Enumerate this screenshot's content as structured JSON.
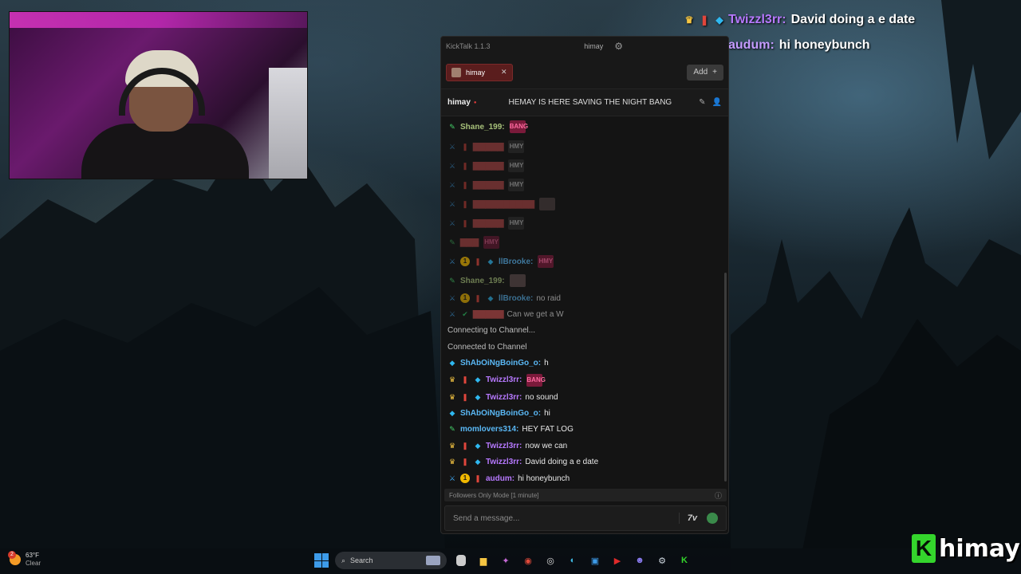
{
  "overlay_chat": [
    {
      "user": "Twizzl3rr:",
      "text": "David doing a e date",
      "user_color": "#b779ff"
    },
    {
      "user": "audum:",
      "text": "hi honeybunch",
      "user_color": "#c59cff"
    }
  ],
  "kicktalk": {
    "app_title": "KickTalk 1.1.3",
    "titlebar_user": "himay",
    "tab_label": "himay",
    "add_label": "Add",
    "channel_name": "himay",
    "stream_title": "HEMAY IS HERE SAVING THE NIGHT BANG",
    "followers_mode": "Followers Only Mode [1 minute]",
    "input_placeholder": "Send a message...",
    "messages": {
      "m1_user": "Shane_199:",
      "m7_user": "llBrooke:",
      "m8_user": "Shane_199:",
      "m9_user": "llBrooke:",
      "m9_text": "no raid",
      "m10_text": "Can we get a W",
      "sys1": "Connecting to Channel...",
      "sys2": "Connected to Channel",
      "m11_user": "ShAbOiNgBoinGo_o:",
      "m11_text": "h",
      "m12_user": "Twizzl3rr:",
      "m13_user": "Twizzl3rr:",
      "m13_text": "no sound",
      "m14_user": "ShAbOiNgBoinGo_o:",
      "m14_text": "hi",
      "m15_user": "momlovers314:",
      "m15_text": "HEY FAT LOG",
      "m16_user": "Twizzl3rr:",
      "m16_text": "now we can",
      "m17_user": "Twizzl3rr:",
      "m17_text": "David doing a e date",
      "m18_user": "audum:",
      "m18_text": "hi honeybunch"
    },
    "emotes": {
      "bang": "BANG",
      "hmy": "HMY"
    }
  },
  "taskbar": {
    "weather_temp": "63°F",
    "weather_desc": "Clear",
    "weather_alert": "2",
    "search_label": "Search"
  },
  "logo_text": "himay",
  "logo_letter": "K",
  "colors": {
    "kick_green": "#34d52c",
    "accent_purple": "#b779ff"
  }
}
